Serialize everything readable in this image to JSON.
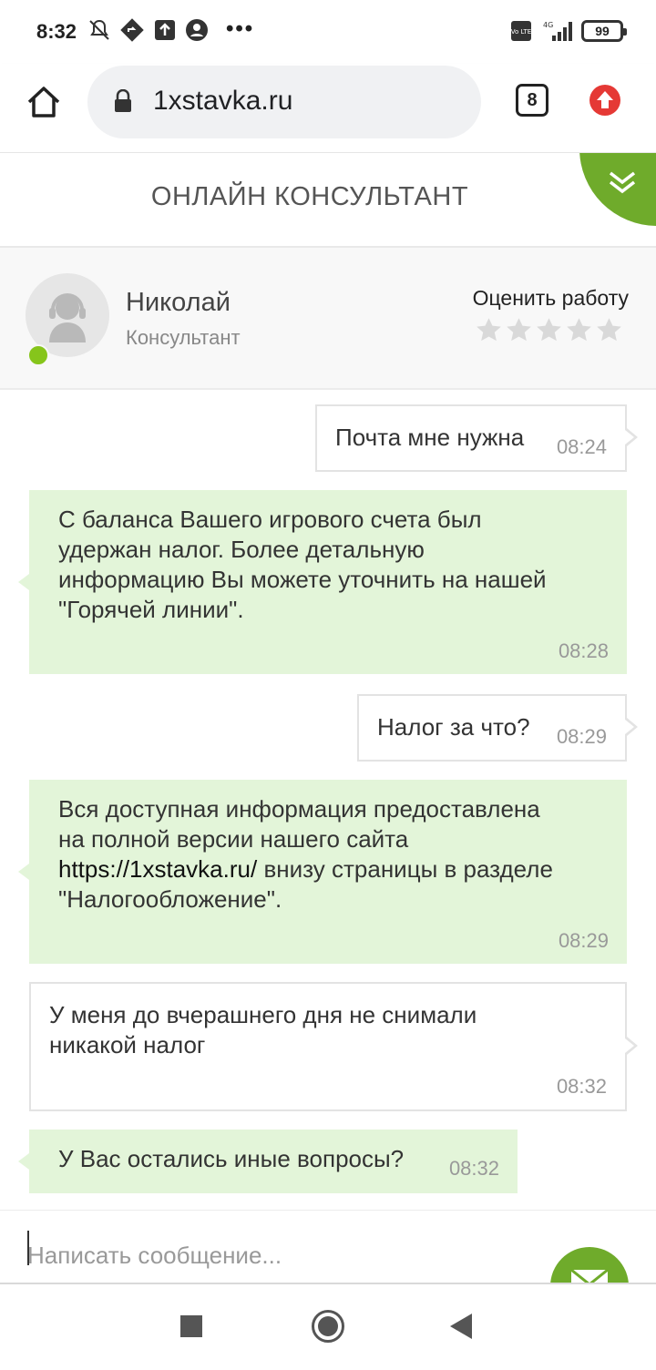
{
  "status_bar": {
    "time": "8:32",
    "battery": "99",
    "network": "4G",
    "volte": "Vo LTE"
  },
  "browser": {
    "url": "1xstavka.ru",
    "tab_count": "8"
  },
  "chat": {
    "title": "ОНЛАЙН КОНСУЛЬТАНТ"
  },
  "consultant": {
    "name": "Николай",
    "role": "Консультант",
    "rate_label": "Оценить работу",
    "rating": 0,
    "max_rating": 5,
    "online": true
  },
  "messages": [
    {
      "from": "user",
      "text": "Почта мне нужна",
      "time": "08:24"
    },
    {
      "from": "operator",
      "lines": [
        "С баланса Вашего игрового счета был",
        "удержан налог. Более детальную",
        "информацию Вы можете уточнить на нашей",
        "\"Горячей линии\"."
      ],
      "time": "08:28"
    },
    {
      "from": "user",
      "text": "Налог за что?",
      "time": "08:29"
    },
    {
      "from": "operator",
      "lines": [
        "Вся доступная информация предоставлена",
        "на полной версии нашего сайта"
      ],
      "link": "https://1xstavka.ru/",
      "after_link": " внизу страницы в разделе",
      "last_line": "\"Налогообложение\".",
      "time": "08:29"
    },
    {
      "from": "user",
      "lines": [
        "У меня до вчерашнего дня не снимали",
        "никакой налог"
      ],
      "time": "08:32"
    },
    {
      "from": "operator",
      "text": "У Вас остались иные вопросы?",
      "time": "08:32"
    }
  ],
  "input": {
    "placeholder": "Написать сообщение..."
  },
  "colors": {
    "accent_green": "#6fab2b",
    "operator_bubble": "#e3f5d9",
    "online_dot": "#86c51b",
    "upload_red": "#e53935"
  }
}
